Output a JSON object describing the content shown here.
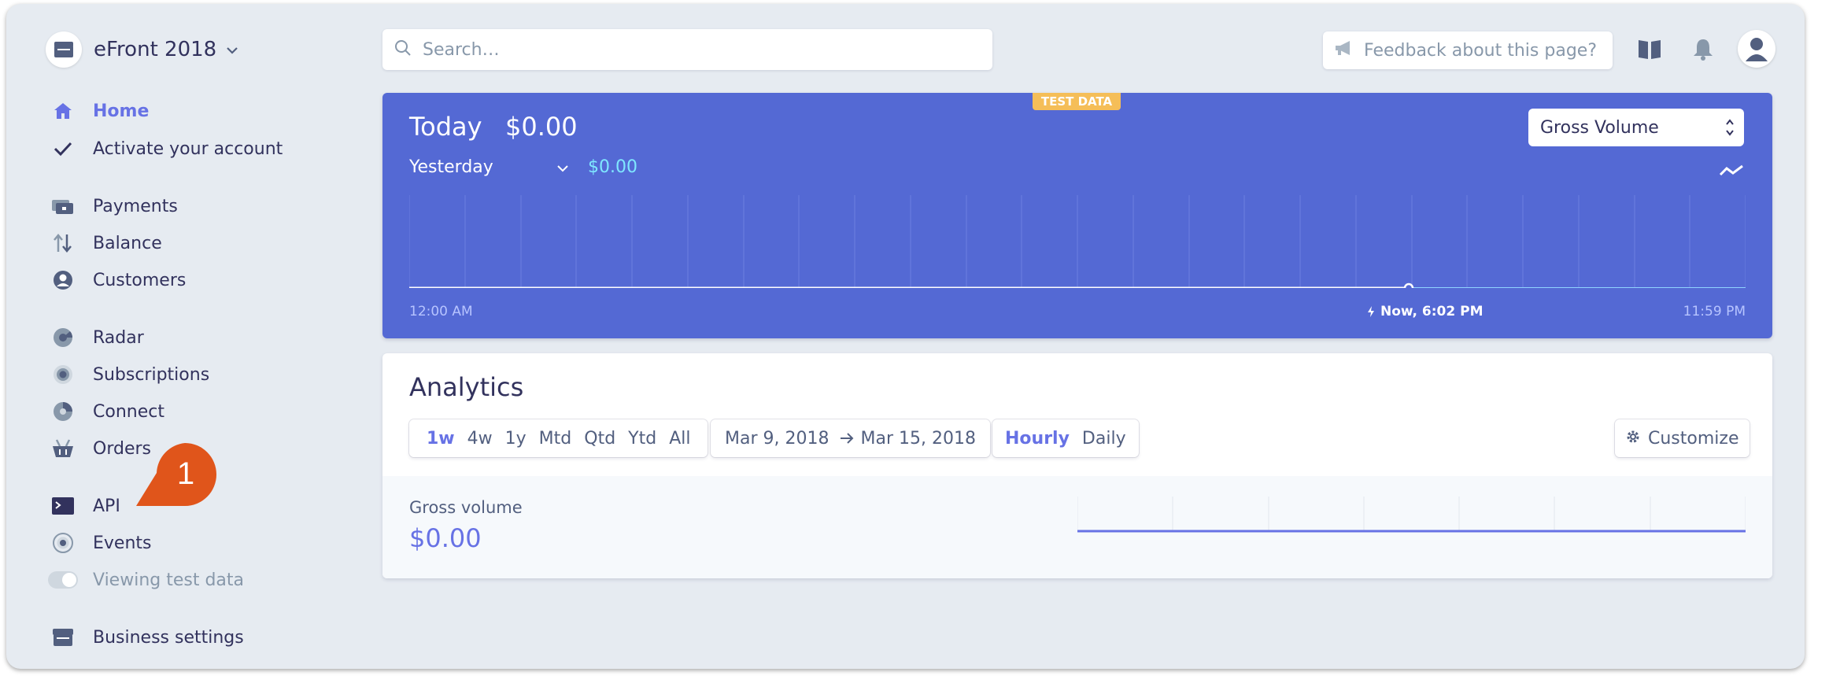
{
  "sidebar": {
    "account": "eFront 2018",
    "items": [
      {
        "label": "Home",
        "icon": "home-icon"
      },
      {
        "label": "Activate your account",
        "icon": "check-icon"
      },
      {
        "label": "Payments",
        "icon": "payments-icon"
      },
      {
        "label": "Balance",
        "icon": "balance-icon"
      },
      {
        "label": "Customers",
        "icon": "customers-icon"
      },
      {
        "label": "Radar",
        "icon": "radar-icon"
      },
      {
        "label": "Subscriptions",
        "icon": "subscriptions-icon"
      },
      {
        "label": "Connect",
        "icon": "connect-icon"
      },
      {
        "label": "Orders",
        "icon": "orders-icon"
      },
      {
        "label": "API",
        "icon": "api-icon"
      },
      {
        "label": "Events",
        "icon": "events-icon"
      },
      {
        "label": "Viewing test data",
        "icon": "toggle-icon"
      },
      {
        "label": "Business settings",
        "icon": "business-icon"
      }
    ],
    "callout_number": "1"
  },
  "topbar": {
    "search_placeholder": "Search…",
    "feedback": "Feedback about this page?"
  },
  "chart_card": {
    "badge": "TEST DATA",
    "today_label": "Today",
    "today_value": "$0.00",
    "compare_label": "Yesterday",
    "compare_value": "$0.00",
    "metric_select": "Gross Volume",
    "axis_start": "12:00 AM",
    "axis_now": "Now, 6:02 PM",
    "axis_end": "11:59 PM"
  },
  "analytics": {
    "title": "Analytics",
    "ranges": [
      "1w",
      "4w",
      "1y",
      "Mtd",
      "Qtd",
      "Ytd",
      "All"
    ],
    "date_from": "Mar 9, 2018",
    "date_to": "Mar 15, 2018",
    "intervals": [
      "Hourly",
      "Daily"
    ],
    "customize": "Customize",
    "metric_label": "Gross volume",
    "metric_value": "$0.00"
  },
  "colors": {
    "accent": "#6772e5",
    "chart_bg": "#5469d4",
    "badge": "#f5be58",
    "callout": "#e0551b"
  }
}
